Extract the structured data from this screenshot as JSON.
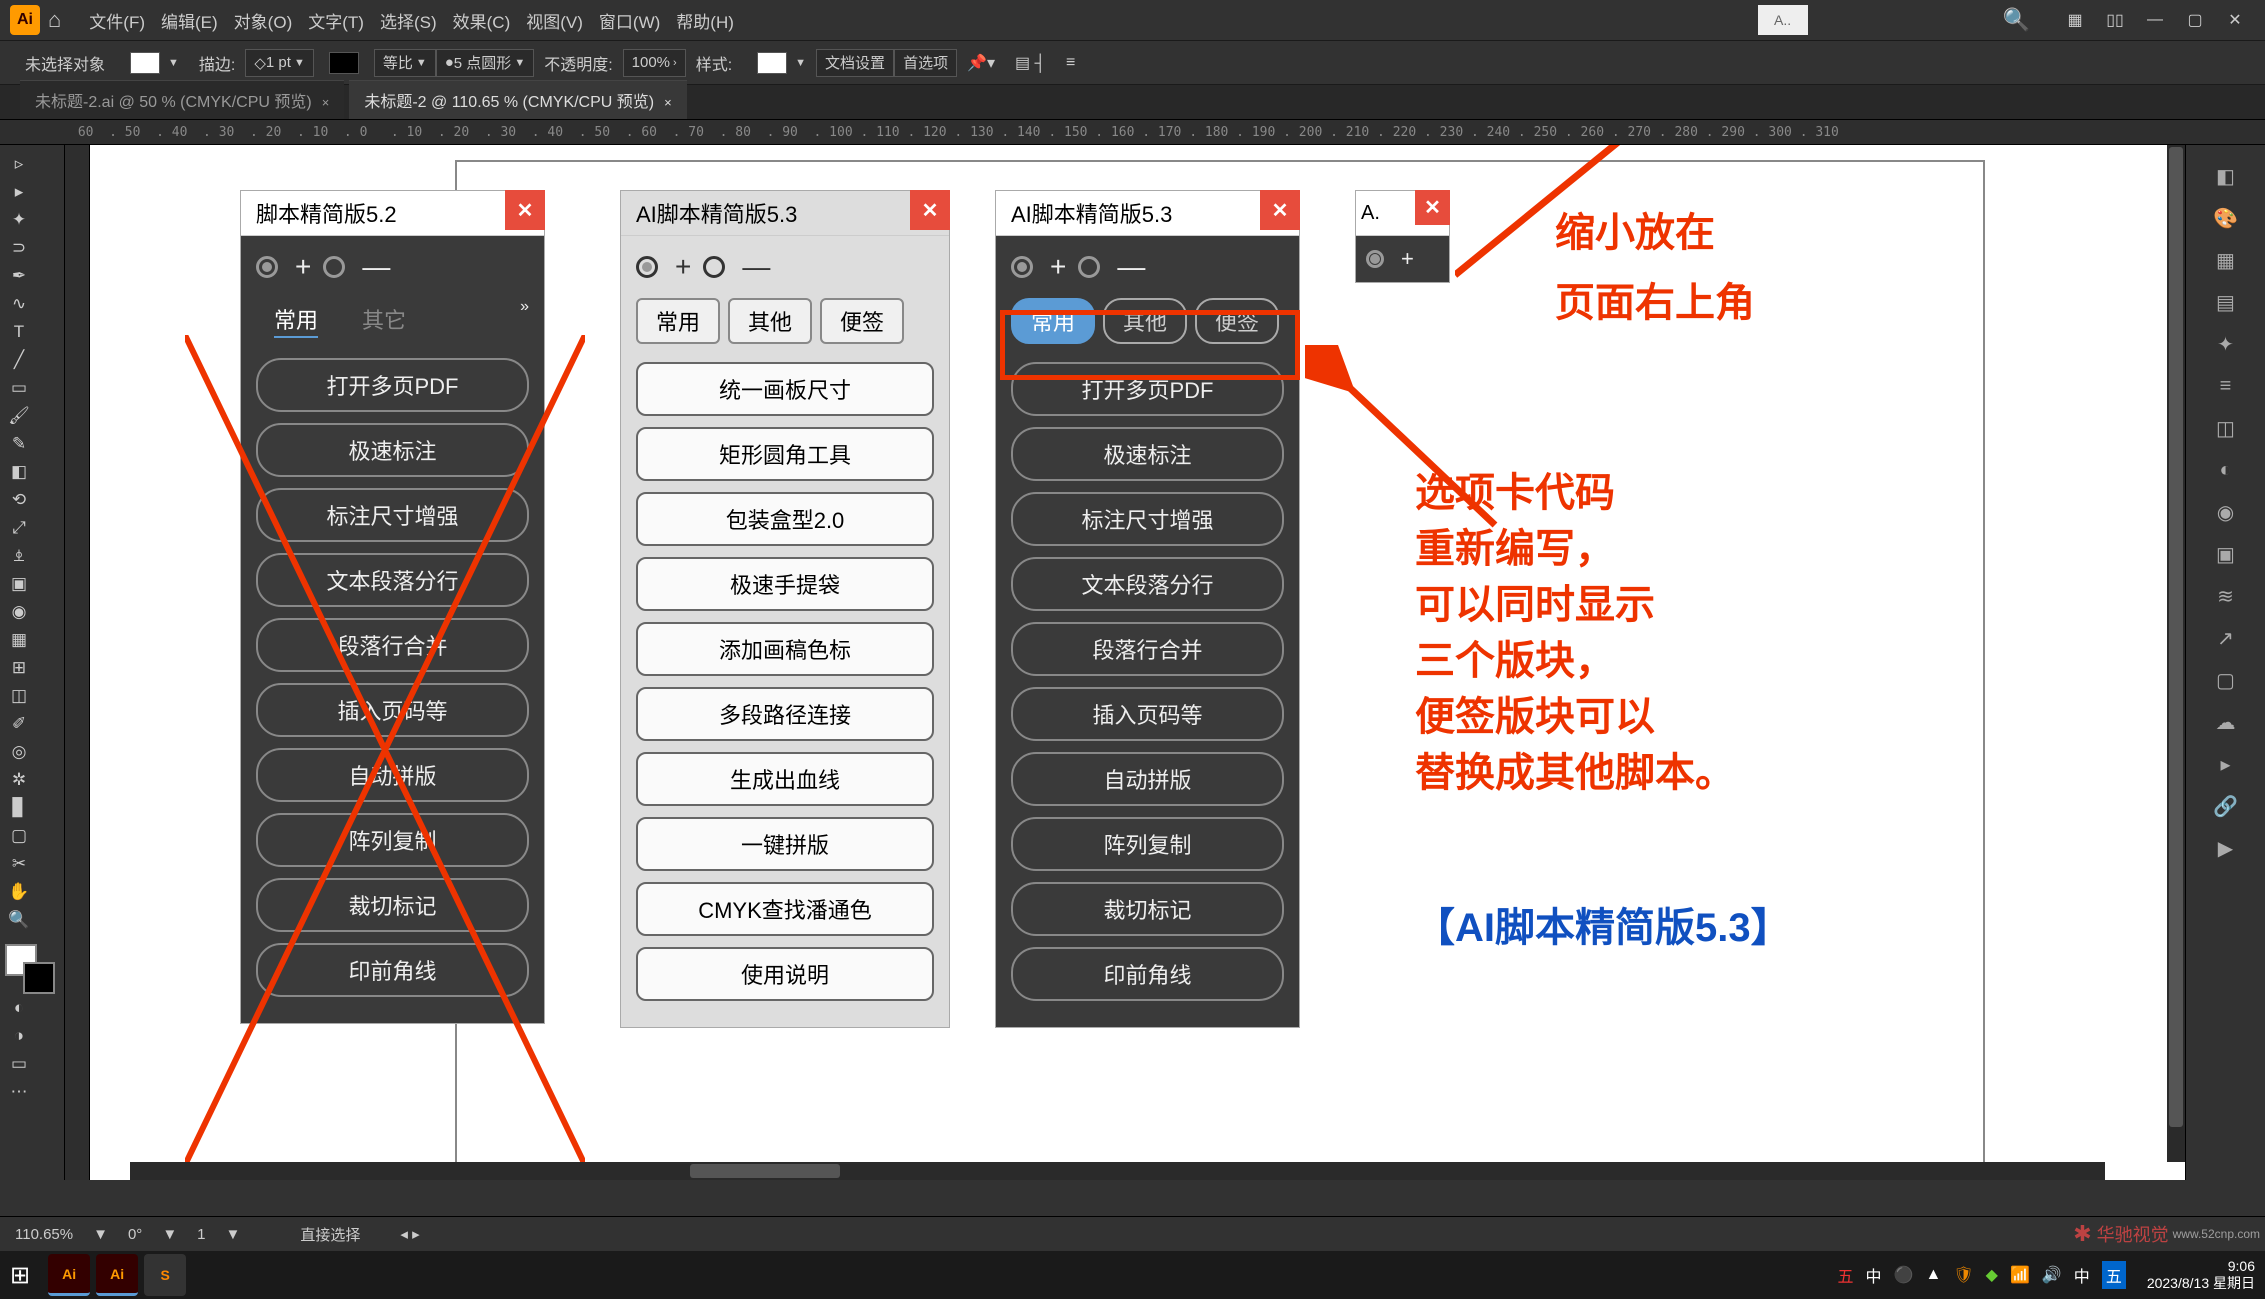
{
  "menubar": {
    "items": [
      "文件(F)",
      "编辑(E)",
      "对象(O)",
      "文字(T)",
      "选择(S)",
      "效果(C)",
      "视图(V)",
      "窗口(W)",
      "帮助(H)"
    ],
    "search_box": "A..",
    "floating_A": "A."
  },
  "controlbar": {
    "no_selection": "未选择对象",
    "stroke": "描边:",
    "stroke_value": "1 pt",
    "uniform": "等比",
    "brush": "5 点圆形",
    "opacity": "不透明度:",
    "opacity_value": "100%",
    "style": "样式:",
    "doc_setup": "文档设置",
    "prefs": "首选项"
  },
  "tabs": {
    "t1": "未标题-2.ai @ 50 % (CMYK/CPU 预览)",
    "t2": "未标题-2 @ 110.65 % (CMYK/CPU 预览)"
  },
  "ruler": " 60  . 50  . 40  . 30  . 20  . 10  . 0   . 10  . 20  . 30  . 40  . 50  . 60  . 70  . 80  . 90  . 100 . 110 . 120 . 130 . 140 . 150 . 160 . 170 . 180 . 190 . 200 . 210 . 220 . 230 . 240 . 250 . 260 . 270 . 280 . 290 . 300 . 310",
  "panel1": {
    "title": "脚本精简版5.2",
    "tabs": [
      "常用",
      "其它"
    ],
    "buttons": [
      "打开多页PDF",
      "极速标注",
      "标注尺寸增强",
      "文本段落分行",
      "段落行合并",
      "插入页码等",
      "自动拼版",
      "阵列复制",
      "裁切标记",
      "印前角线"
    ]
  },
  "panel2": {
    "title": "AI脚本精简版5.3",
    "tabs": [
      "常用",
      "其他",
      "便签"
    ],
    "buttons": [
      "统一画板尺寸",
      "矩形圆角工具",
      "包装盒型2.0",
      "极速手提袋",
      "添加画稿色标",
      "多段路径连接",
      "生成出血线",
      "一键拼版",
      "CMYK查找潘通色",
      "使用说明"
    ]
  },
  "panel3": {
    "title": "AI脚本精简版5.3",
    "tabs": [
      "常用",
      "其他",
      "便签"
    ],
    "buttons": [
      "打开多页PDF",
      "极速标注",
      "标注尺寸增强",
      "文本段落分行",
      "段落行合并",
      "插入页码等",
      "自动拼版",
      "阵列复制",
      "裁切标记",
      "印前角线"
    ]
  },
  "panel4": {
    "title": "A."
  },
  "annotations": {
    "top1": "缩小放在",
    "top2": "页面右上角",
    "mid": "选项卡代码\n重新编写，\n可以同时显示\n三个版块，\n便签版块可以\n替换成其他脚本。",
    "bottom": "【AI脚本精简版5.3】"
  },
  "status": {
    "zoom": "110.65%",
    "rotate": "0°",
    "artboard": "1",
    "mode": "直接选择"
  },
  "taskbar": {
    "time": "9:06",
    "date": "2023/8/13 星期日"
  },
  "watermark": "华驰视觉"
}
